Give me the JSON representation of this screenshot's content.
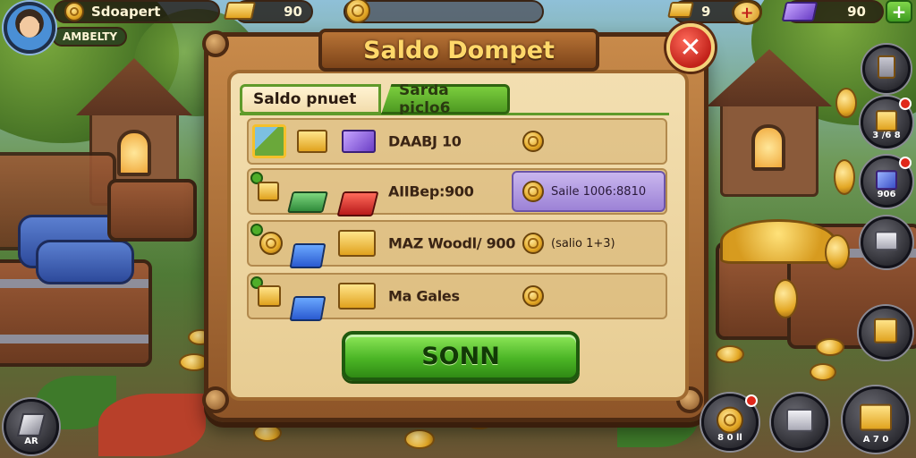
{
  "hud": {
    "player_name": "Sdoapert",
    "player_rank": "AMBELTY",
    "bars_count": "90",
    "gold_count": "9",
    "gems_count": "90",
    "add_label": "+"
  },
  "modal": {
    "title": "Saldo Dompet",
    "close_label": "✕",
    "tabs": [
      {
        "label": "Saldo pnuet"
      },
      {
        "label": "Sarda piclo6"
      }
    ],
    "rows": [
      {
        "label": "DAABJ 10",
        "value": ""
      },
      {
        "label": "AIIBep:900",
        "value": "Saile 1006:8810"
      },
      {
        "label": "MAZ Woodl/ 900",
        "value": "(salio 1+3)"
      },
      {
        "label": "Ma Gales",
        "value": ""
      }
    ],
    "confirm_label": "SONN"
  },
  "side_buttons": [
    {
      "caption": ""
    },
    {
      "caption": "3 /6 8"
    },
    {
      "caption": "906"
    },
    {
      "caption": ""
    },
    {
      "caption": ""
    }
  ],
  "bottom_buttons": {
    "left_caption": "AR",
    "coins_caption": "8 0 ll",
    "box_caption": "",
    "gold_caption": "A 7 0"
  },
  "colors": {
    "confirm_green": "#4cb626",
    "frame_brown": "#8e5528",
    "title_gold": "#ffd86a",
    "close_red": "#c2221a",
    "highlight_purple": "#9c82d6"
  }
}
